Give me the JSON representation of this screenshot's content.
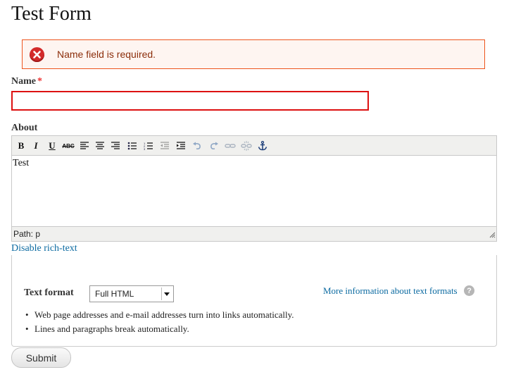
{
  "page": {
    "title": "Test Form"
  },
  "error": {
    "message": "Name field is required.",
    "icon": "error-x-icon",
    "color": "#ed541d"
  },
  "name_field": {
    "label": "Name",
    "required_marker": "*",
    "value": ""
  },
  "about_field": {
    "label": "About",
    "toolbar": [
      {
        "name": "bold-button",
        "glyph": "B",
        "icon": "bold-icon"
      },
      {
        "name": "italic-button",
        "glyph": "I",
        "icon": "italic-icon"
      },
      {
        "name": "underline-button",
        "glyph": "U",
        "icon": "underline-icon"
      },
      {
        "name": "strikethrough-button",
        "glyph": "ABC",
        "icon": "strikethrough-icon"
      },
      {
        "name": "align-left-button",
        "icon": "align-left-icon"
      },
      {
        "name": "align-center-button",
        "icon": "align-center-icon"
      },
      {
        "name": "align-right-button",
        "icon": "align-right-icon"
      },
      {
        "name": "bullet-list-button",
        "icon": "bullet-list-icon"
      },
      {
        "name": "numbered-list-button",
        "icon": "numbered-list-icon"
      },
      {
        "name": "outdent-button",
        "icon": "outdent-icon"
      },
      {
        "name": "indent-button",
        "icon": "indent-icon"
      },
      {
        "name": "undo-button",
        "icon": "undo-icon"
      },
      {
        "name": "redo-button",
        "icon": "redo-icon"
      },
      {
        "name": "link-button",
        "icon": "link-icon"
      },
      {
        "name": "unlink-button",
        "icon": "unlink-icon"
      },
      {
        "name": "anchor-button",
        "icon": "anchor-icon"
      }
    ],
    "content": "Test",
    "status_path": "Path: p",
    "disable_link": "Disable rich-text"
  },
  "text_format": {
    "label": "Text format",
    "selected": "Full HTML",
    "more_info_link": "More information about text formats",
    "help_icon": "?",
    "tips": [
      "Web page addresses and e-mail addresses turn into links automatically.",
      "Lines and paragraphs break automatically."
    ]
  },
  "submit": {
    "label": "Submit"
  }
}
